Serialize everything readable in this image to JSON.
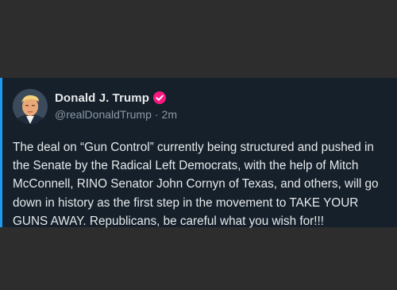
{
  "post": {
    "display_name": "Donald J. Trump",
    "handle": "@realDonaldTrump",
    "separator": "·",
    "time": "2m",
    "verified_icon": "verified-badge-icon",
    "text": "The deal on “Gun Control” currently being structured and pushed in the Senate by the Radical Left Democrats, with the help of Mitch McConnell, RINO Senator John Cornyn of Texas, and others, will go down in history as the first step in the movement to TAKE YOUR GUNS AWAY. Republicans, be careful what you wish for!!!"
  },
  "colors": {
    "page_background": "#2d2d2d",
    "card_background": "#15202b",
    "accent": "#1d9bf0",
    "verified_badge": "#f91880",
    "primary_text": "#e7e9ea",
    "secondary_text": "#8b98a5"
  }
}
